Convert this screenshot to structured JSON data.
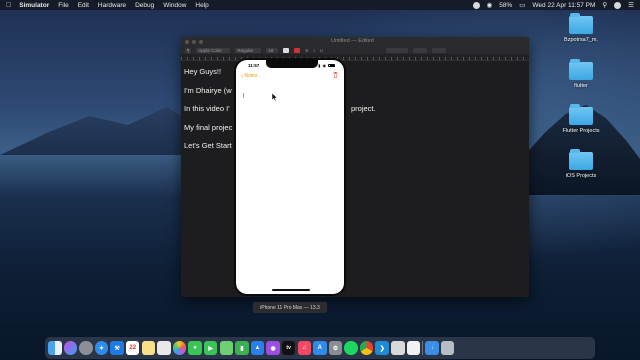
{
  "menubar": {
    "app": "Simulator",
    "items": [
      "File",
      "Edit",
      "Hardware",
      "Debug",
      "Window",
      "Help"
    ],
    "battery": "58%",
    "datetime": "Wed 22 Apr  11:57 PM"
  },
  "desktop_icons": [
    {
      "label": "Bzpotrsa7_m."
    },
    {
      "label": "flutter"
    },
    {
      "label": "Flutter Projects"
    },
    {
      "label": "iOS Projects"
    }
  ],
  "textedit": {
    "title": "Untitled — Edited",
    "font_name": "Apple Color Emoji",
    "font_style": "Regular",
    "font_size": "18",
    "lines": [
      "Hey Guys!!",
      "I'm Dhairye (w",
      "In this video I'",
      "My final projec",
      "Let's Get Start"
    ],
    "overflow_text": "project."
  },
  "simulator": {
    "time": "11:57",
    "back_label": "Notes",
    "device": "iPhone 11 Pro Max — 13.3"
  },
  "colors": {
    "notes_accent": "#e5a100",
    "trash": "#e0483c"
  },
  "dock_icons": [
    "finder-icon",
    "siri-icon",
    "launchpad-icon",
    "safari-icon",
    "xcode-icon",
    "calendar-icon",
    "notes-icon",
    "preview-icon",
    "photos-icon",
    "messages-icon",
    "facetime-icon",
    "maps-icon",
    "numbers-icon",
    "keynote-icon",
    "podcasts-icon",
    "appletv-icon",
    "music-icon",
    "appstore-icon",
    "settings-icon",
    "spotify-icon",
    "chrome-icon",
    "vscode-icon",
    "simulator-icon",
    "textedit-icon",
    "downloads-icon",
    "trash-icon"
  ]
}
